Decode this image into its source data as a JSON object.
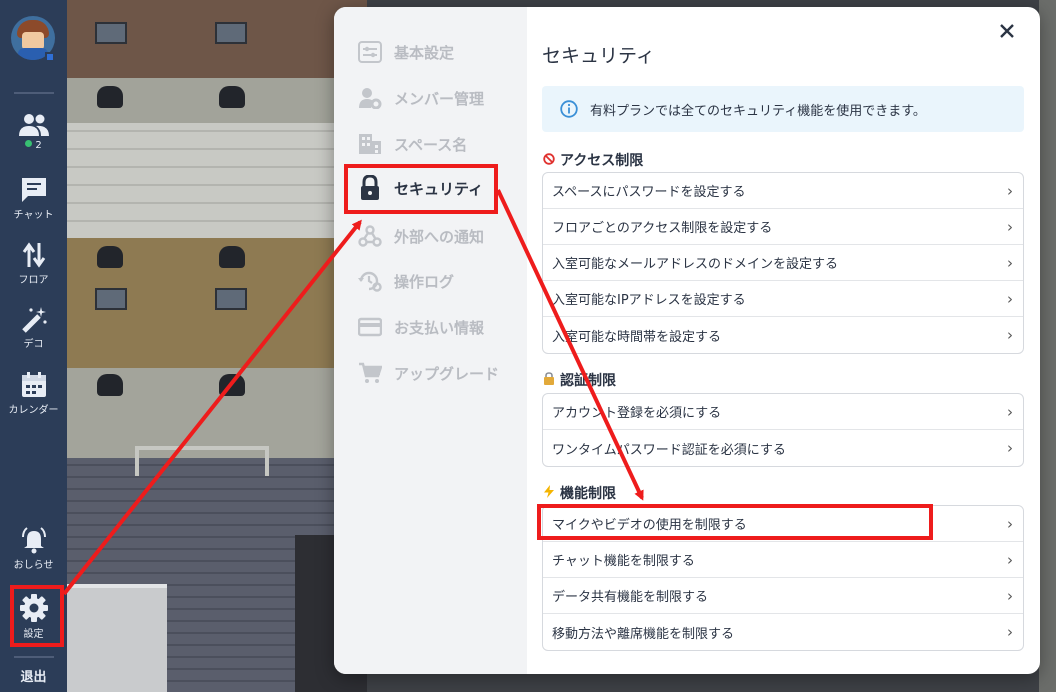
{
  "rail": {
    "online_count": "2",
    "items": [
      {
        "name": "members",
        "label": ""
      },
      {
        "name": "chat",
        "label": "チャット"
      },
      {
        "name": "floor",
        "label": "フロア"
      },
      {
        "name": "deco",
        "label": "デコ"
      },
      {
        "name": "calendar",
        "label": "カレンダー"
      },
      {
        "name": "notice",
        "label": "おしらせ"
      },
      {
        "name": "settings",
        "label": "設定"
      }
    ],
    "exit_label": "退出"
  },
  "sidebar": {
    "items": [
      {
        "label": "基本設定",
        "icon": "settings-panel-icon"
      },
      {
        "label": "メンバー管理",
        "icon": "user-gear-icon"
      },
      {
        "label": "スペース名",
        "icon": "building-icon"
      },
      {
        "label": "セキュリティ",
        "icon": "lock-icon"
      },
      {
        "label": "外部への通知",
        "icon": "webhook-icon"
      },
      {
        "label": "操作ログ",
        "icon": "history-gear-icon"
      },
      {
        "label": "お支払い情報",
        "icon": "credit-card-icon"
      },
      {
        "label": "アップグレード",
        "icon": "cart-icon"
      }
    ],
    "active_index": 3
  },
  "main": {
    "title": "セキュリティ",
    "info": "有料プランでは全てのセキュリティ機能を使用できます。",
    "sections": [
      {
        "heading": "アクセス制限",
        "icon": "prohibited-icon",
        "rows": [
          "スペースにパスワードを設定する",
          "フロアごとのアクセス制限を設定する",
          "入室可能なメールアドレスのドメインを設定する",
          "入室可能なIPアドレスを設定する",
          "入室可能な時間帯を設定する"
        ]
      },
      {
        "heading": "認証制限",
        "icon": "locked-with-key-icon",
        "rows": [
          "アカウント登録を必須にする",
          "ワンタイムパスワード認証を必須にする"
        ]
      },
      {
        "heading": "機能制限",
        "icon": "lightning-icon",
        "rows": [
          "マイクやビデオの使用を制限する",
          "チャット機能を制限する",
          "データ共有機能を制限する",
          "移動方法や離席機能を制限する"
        ]
      }
    ]
  },
  "colors": {
    "rail_bg": "#2c3d58",
    "highlight": "#ee1c1c",
    "info_bg": "#eaf5fc",
    "online_dot": "#38c172"
  }
}
